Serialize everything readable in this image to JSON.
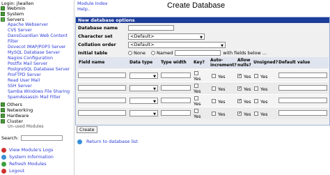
{
  "sidebar": {
    "login_label": "Login: jlwallen",
    "categories": [
      {
        "label": "Webmin"
      },
      {
        "label": "System"
      },
      {
        "label": "Servers"
      }
    ],
    "servers": [
      "Apache Webserver",
      "CVS Server",
      "DansGuardian Web Content",
      "Filter",
      "Dovecot IMAP/POP3 Server",
      "MySQL Database Server",
      "Nagios Configuration",
      "Postfix Mail Server",
      "PostgreSQL Database Server",
      "ProFTPD Server",
      "Read User Mail",
      "SSH Server",
      "Samba Windows File Sharing",
      "SpamAssassin Mail Filter"
    ],
    "categories_after": [
      {
        "label": "Others"
      },
      {
        "label": "Networking"
      },
      {
        "label": "Hardware"
      },
      {
        "label": "Cluster"
      }
    ],
    "unused_modules": "Un-used Modules",
    "search_label": "Search:",
    "actions": [
      {
        "label": "View Module's Logs",
        "color": "#d03030"
      },
      {
        "label": "System Information",
        "color": "#3a8fd8"
      },
      {
        "label": "Refresh Modules",
        "color": "#3aa040"
      },
      {
        "label": "Logout",
        "color": "#d03030"
      }
    ]
  },
  "main": {
    "module_index": "Module Index",
    "help": "Help..",
    "title": "Create Database",
    "panel_header": "New database options",
    "db_name_label": "Database name",
    "charset_label": "Character set",
    "charset_value": "<Default>",
    "collation_label": "Collation order",
    "collation_value": "<Default>",
    "initial_table_label": "Initial table",
    "opt_none": "None",
    "opt_named": "Named",
    "fields_below": "with fields below ...",
    "columns": {
      "field_name": "Field name",
      "data_type": "Data type",
      "type_width": "Type width",
      "key": "Key?",
      "auto_inc": "Auto-\nincrement?",
      "allow_nulls": "Allow\nnulls?",
      "unsigned": "Unsigned?",
      "default_value": "Default value"
    },
    "yes": "Yes",
    "create_button": "Create",
    "return_link": "Return to database list"
  }
}
